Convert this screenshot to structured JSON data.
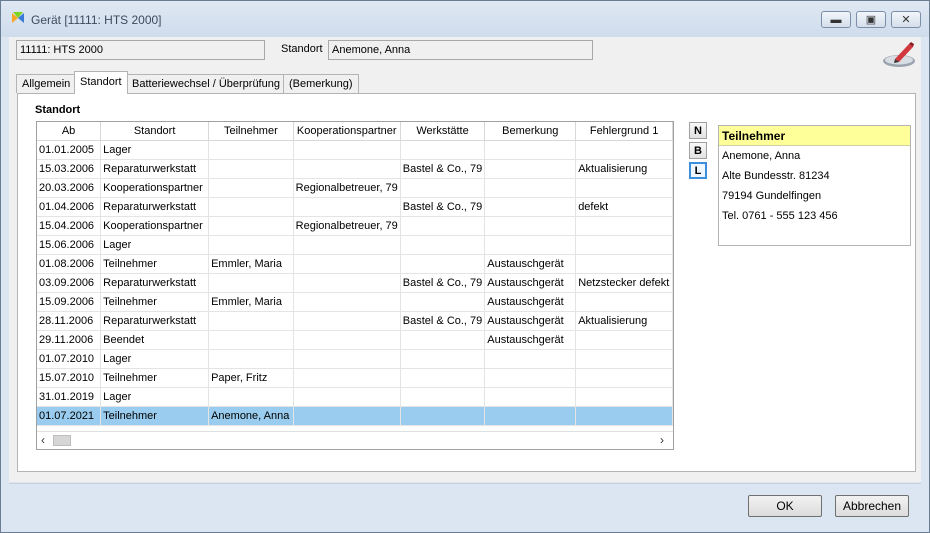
{
  "window": {
    "title": "Gerät [11111: HTS 2000]",
    "minimize_icon": "minimize-icon",
    "maximize_icon": "maximize-icon",
    "close_icon": "close-icon"
  },
  "header": {
    "device_value": "11111: HTS 2000",
    "standort_label": "Standort",
    "standort_value": "Anemone, Anna",
    "tool_icon": "edit-pen-icon"
  },
  "tabs": [
    {
      "label": "Allgemein",
      "active": false
    },
    {
      "label": "Standort",
      "active": true
    },
    {
      "label": "Batteriewechsel / Überprüfung",
      "active": false
    },
    {
      "label": "(Bemerkung)",
      "active": false
    }
  ],
  "section_title": "Standort",
  "grid": {
    "columns": [
      "Ab",
      "Standort",
      "Teilnehmer",
      "Kooperationspartner",
      "Werkstätte",
      "Bemerkung",
      "Fehlergrund 1"
    ],
    "rows": [
      [
        "01.01.2005",
        "Lager",
        "",
        "",
        "",
        "",
        ""
      ],
      [
        "15.03.2006",
        "Reparaturwerkstatt",
        "",
        "",
        "Bastel & Co., 79",
        "",
        "Aktualisierung"
      ],
      [
        "20.03.2006",
        "Kooperationspartner",
        "",
        "Regionalbetreuer, 79",
        "",
        "",
        ""
      ],
      [
        "01.04.2006",
        "Reparaturwerkstatt",
        "",
        "",
        "Bastel & Co., 79",
        "",
        "defekt"
      ],
      [
        "15.04.2006",
        "Kooperationspartner",
        "",
        "Regionalbetreuer, 79",
        "",
        "",
        ""
      ],
      [
        "15.06.2006",
        "Lager",
        "",
        "",
        "",
        "",
        ""
      ],
      [
        "01.08.2006",
        "Teilnehmer",
        "Emmler, Maria",
        "",
        "",
        "Austauschgerät",
        ""
      ],
      [
        "03.09.2006",
        "Reparaturwerkstatt",
        "",
        "",
        "Bastel & Co., 79",
        "Austauschgerät",
        "Netzstecker defekt"
      ],
      [
        "15.09.2006",
        "Teilnehmer",
        "Emmler, Maria",
        "",
        "",
        "Austauschgerät",
        ""
      ],
      [
        "28.11.2006",
        "Reparaturwerkstatt",
        "",
        "",
        "Bastel & Co., 79",
        "Austauschgerät",
        "Aktualisierung"
      ],
      [
        "29.11.2006",
        "Beendet",
        "",
        "",
        "",
        "Austauschgerät",
        ""
      ],
      [
        "01.07.2010",
        "Lager",
        "",
        "",
        "",
        "",
        ""
      ],
      [
        "15.07.2010",
        "Teilnehmer",
        "Paper, Fritz",
        "",
        "",
        "",
        ""
      ],
      [
        "31.01.2019",
        "Lager",
        "",
        "",
        "",
        "",
        ""
      ],
      [
        "01.07.2021",
        "Teilnehmer",
        "Anemone, Anna",
        "",
        "",
        "",
        ""
      ]
    ],
    "selected_row": 14,
    "scroll_left_icon": "chevron-left-icon",
    "scroll_right_icon": "chevron-right-icon"
  },
  "side_buttons": [
    {
      "label": "N",
      "active": false
    },
    {
      "label": "B",
      "active": false
    },
    {
      "label": "L",
      "active": true
    }
  ],
  "info_panel": {
    "heading": "Teilnehmer",
    "lines": [
      "Anemone, Anna",
      "Alte Bundesstr. 81234",
      "79194 Gundelfingen",
      "Tel. 0761 - 555 123 456"
    ]
  },
  "footer": {
    "ok_label": "OK",
    "cancel_label": "Abbrechen"
  },
  "colors": {
    "selected_row": "#99ccee",
    "info_header": "#ffff99",
    "active_side_button_border": "#3c8fdc"
  }
}
